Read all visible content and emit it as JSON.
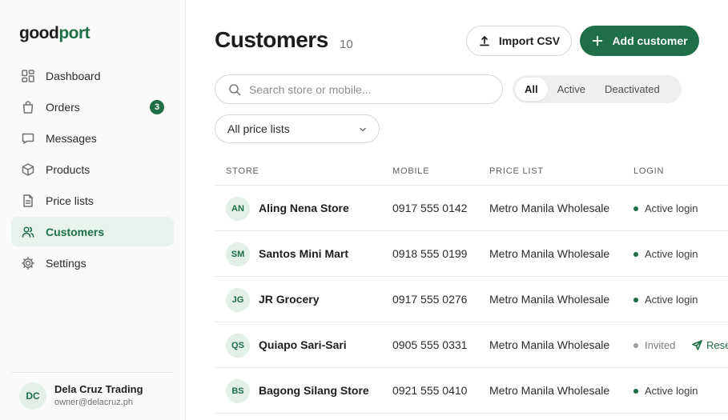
{
  "brand": {
    "part1": "good",
    "part2": "port"
  },
  "sidebar": {
    "items": [
      {
        "label": "Dashboard",
        "icon": "dashboard-icon"
      },
      {
        "label": "Orders",
        "icon": "bag-icon",
        "badge": "3"
      },
      {
        "label": "Messages",
        "icon": "message-icon"
      },
      {
        "label": "Products",
        "icon": "box-icon"
      },
      {
        "label": "Price lists",
        "icon": "document-icon"
      },
      {
        "label": "Customers",
        "icon": "users-icon",
        "active": true
      },
      {
        "label": "Settings",
        "icon": "gear-icon"
      }
    ],
    "account": {
      "initials": "DC",
      "name": "Dela Cruz Trading",
      "email": "owner@delacruz.ph"
    }
  },
  "header": {
    "title": "Customers",
    "count": "10",
    "import_label": "Import CSV",
    "add_label": "Add customer"
  },
  "filters": {
    "search_placeholder": "Search store or mobile...",
    "tabs": [
      "All",
      "Active",
      "Deactivated"
    ],
    "selected_tab": "All",
    "price_list": "All price lists"
  },
  "table": {
    "columns": [
      "STORE",
      "MOBILE",
      "PRICE LIST",
      "LOGIN"
    ],
    "rows": [
      {
        "initials": "AN",
        "store": "Aling Nena Store",
        "mobile": "0917 555 0142",
        "price_list": "Metro Manila Wholesale",
        "login": "Active login",
        "status": "active"
      },
      {
        "initials": "SM",
        "store": "Santos Mini Mart",
        "mobile": "0918 555 0199",
        "price_list": "Metro Manila Wholesale",
        "login": "Active login",
        "status": "active"
      },
      {
        "initials": "JG",
        "store": "JR Grocery",
        "mobile": "0917 555 0276",
        "price_list": "Metro Manila Wholesale",
        "login": "Active login",
        "status": "active"
      },
      {
        "initials": "QS",
        "store": "Quiapo Sari-Sari",
        "mobile": "0905 555 0331",
        "price_list": "Metro Manila Wholesale",
        "login": "Invited",
        "status": "invited",
        "action": "Rese"
      },
      {
        "initials": "BS",
        "store": "Bagong Silang Store",
        "mobile": "0921 555 0410",
        "price_list": "Metro Manila Wholesale",
        "login": "Active login",
        "status": "active"
      }
    ]
  },
  "colors": {
    "accent": "#1e6e47",
    "active_dot": "#1e6e47",
    "invited_dot": "#9a9e9c"
  }
}
